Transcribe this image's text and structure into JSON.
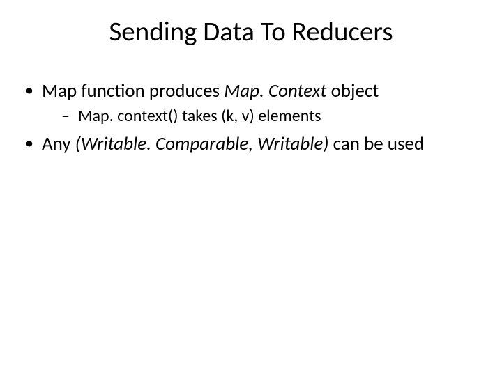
{
  "title": "Sending Data To Reducers",
  "bullets": {
    "b1_pre": "Map function produces ",
    "b1_ital": "Map. Context",
    "b1_post": " object",
    "b1_sub": "Map. context() takes (k, v) elements",
    "b2_pre": "Any ",
    "b2_ital": "(Writable. Comparable, Writable)",
    "b2_post": " can be used"
  }
}
